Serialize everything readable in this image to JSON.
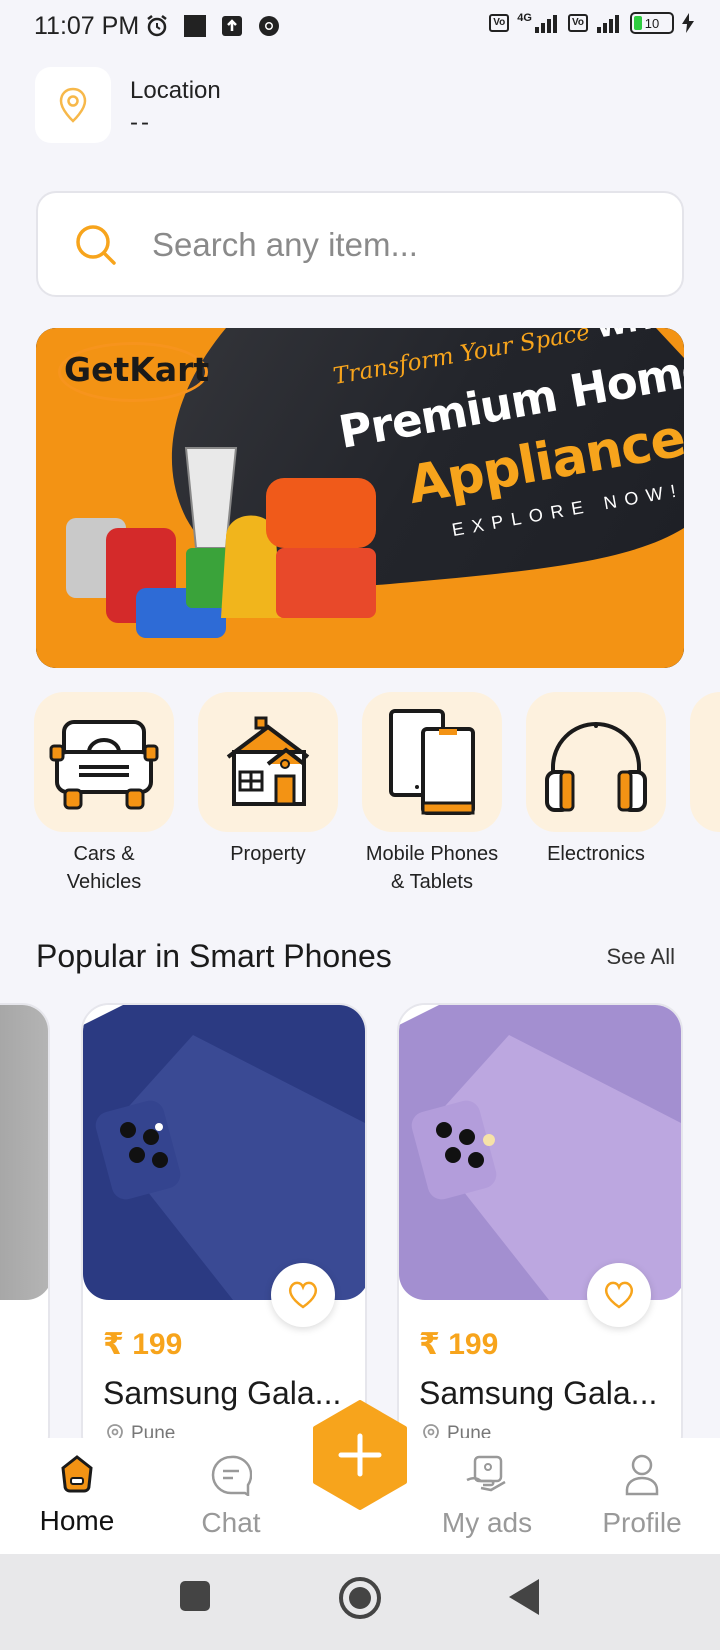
{
  "status_bar": {
    "time": "11:07 PM",
    "network_label": "4G",
    "sim_chip": "Vo LTE",
    "battery": "10"
  },
  "location": {
    "label": "Location",
    "value": "--"
  },
  "search": {
    "placeholder": "Search any item..."
  },
  "banner": {
    "logo": "GetKart",
    "line1": "Transform Your Space",
    "line1_bold": "WITH",
    "line2": "Premium Home",
    "line3": "Appliances",
    "line4": "EXPLORE NOW!"
  },
  "categories": [
    {
      "label": "Cars & Vehicles",
      "icon": "car-icon"
    },
    {
      "label": "Property",
      "icon": "house-icon"
    },
    {
      "label": "Mobile Phones & Tablets",
      "icon": "phone-icon"
    },
    {
      "label": "Electronics",
      "icon": "headphones-icon"
    }
  ],
  "section": {
    "title": "Popular in Smart Phones",
    "see_all": "See All"
  },
  "products": [
    {
      "price": "₹ 199",
      "name": "Samsung Gala...",
      "location": "Pune",
      "color": "#2f3f86"
    },
    {
      "price": "₹ 199",
      "name": "Samsung Gala...",
      "location": "Pune",
      "color": "#b7a2dc"
    }
  ],
  "bottom_nav": {
    "home": "Home",
    "chat": "Chat",
    "my_ads": "My ads",
    "profile": "Profile"
  },
  "colors": {
    "accent": "#f7a41c",
    "background": "#f5f5fa"
  }
}
